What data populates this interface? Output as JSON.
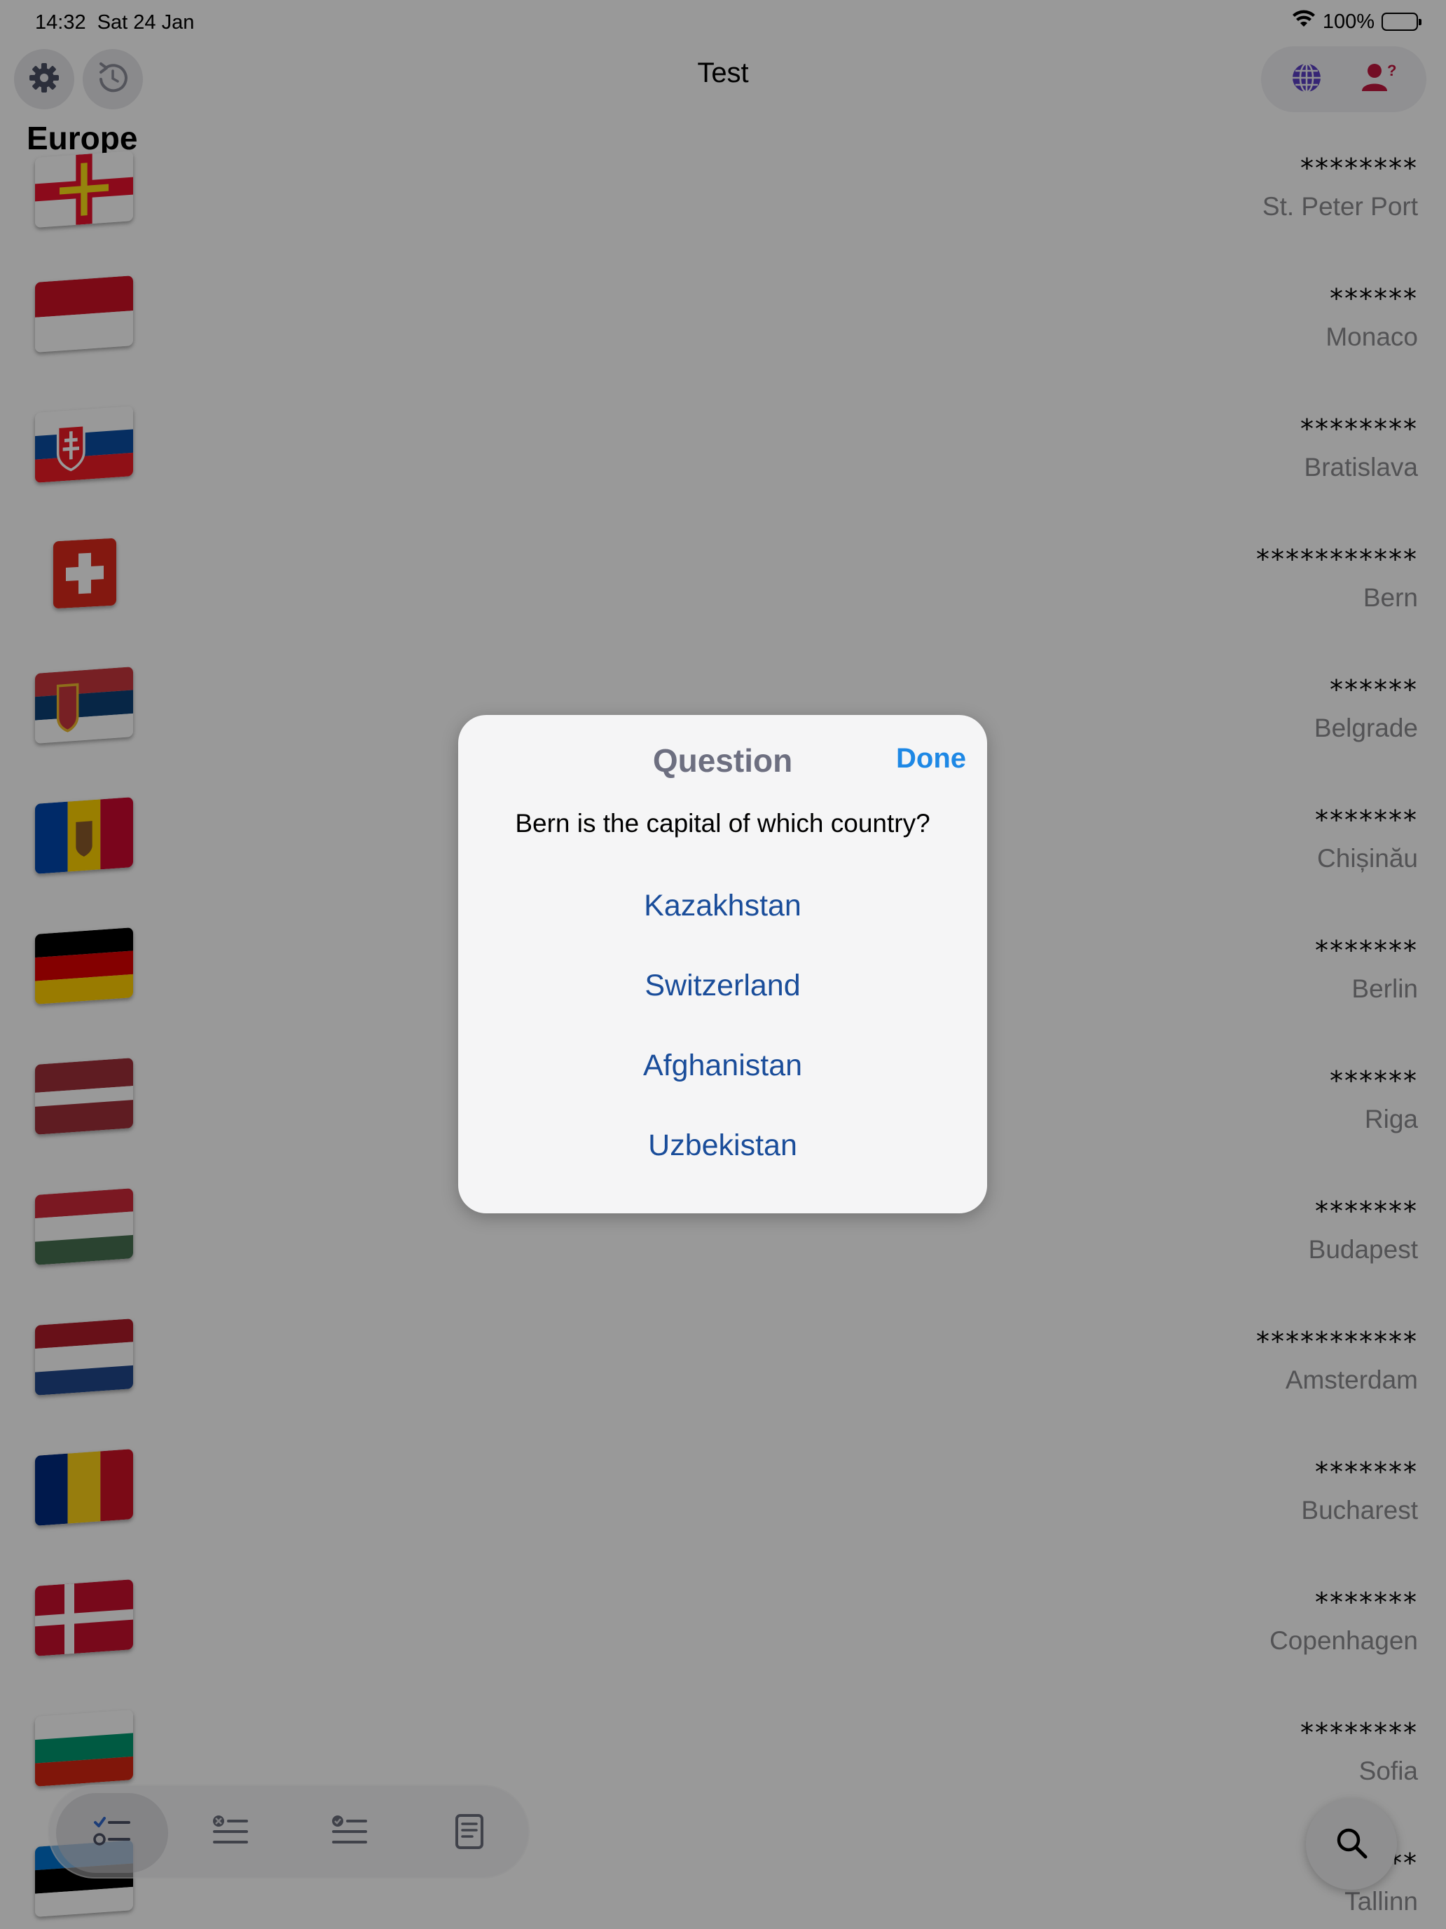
{
  "status_bar": {
    "time": "14:32",
    "date": "Sat 24 Jan",
    "battery": "100%"
  },
  "nav": {
    "title": "Test",
    "settings_icon": "gear-icon",
    "reset_icon": "arrow-counterclockwise-icon",
    "globe_icon": "globe-icon",
    "person_question_icon": "person-question-icon"
  },
  "section_title": "Europe",
  "rows": [
    {
      "flag": "guernsey",
      "stars": "********",
      "capital": "St. Peter Port"
    },
    {
      "flag": "monaco",
      "stars": "******",
      "capital": "Monaco"
    },
    {
      "flag": "slovakia",
      "stars": "********",
      "capital": "Bratislava"
    },
    {
      "flag": "switzerland",
      "stars": "***********",
      "capital": "Bern"
    },
    {
      "flag": "serbia",
      "stars": "******",
      "capital": "Belgrade"
    },
    {
      "flag": "moldova",
      "stars": "*******",
      "capital": "Chișinău"
    },
    {
      "flag": "germany",
      "stars": "*******",
      "capital": "Berlin"
    },
    {
      "flag": "latvia",
      "stars": "******",
      "capital": "Riga"
    },
    {
      "flag": "hungary",
      "stars": "*******",
      "capital": "Budapest"
    },
    {
      "flag": "netherlands",
      "stars": "***********",
      "capital": "Amsterdam"
    },
    {
      "flag": "romania",
      "stars": "*******",
      "capital": "Bucharest"
    },
    {
      "flag": "denmark",
      "stars": "*******",
      "capital": "Copenhagen"
    },
    {
      "flag": "bulgaria",
      "stars": "********",
      "capital": "Sofia"
    },
    {
      "flag": "estonia",
      "stars": "**",
      "capital": "Tallinn"
    }
  ],
  "dialog": {
    "title": "Question",
    "done_label": "Done",
    "question": "Bern is the capital of which country?",
    "answers": [
      "Kazakhstan",
      "Switzerland",
      "Afghanistan",
      "Uzbekistan"
    ]
  },
  "tabbar": {
    "tabs": [
      {
        "icon": "checklist-icon",
        "active": true
      },
      {
        "icon": "list-xmark-icon",
        "active": false
      },
      {
        "icon": "list-check-icon",
        "active": false
      },
      {
        "icon": "document-icon",
        "active": false
      }
    ],
    "search_icon": "search-icon"
  },
  "colors": {
    "accent": "#1e88e5",
    "answer_text": "#1a4d9a",
    "dialog_title": "#6d6f80",
    "capital_text": "#8a8a8e",
    "overlay": "rgba(0,0,0,0.40)"
  }
}
